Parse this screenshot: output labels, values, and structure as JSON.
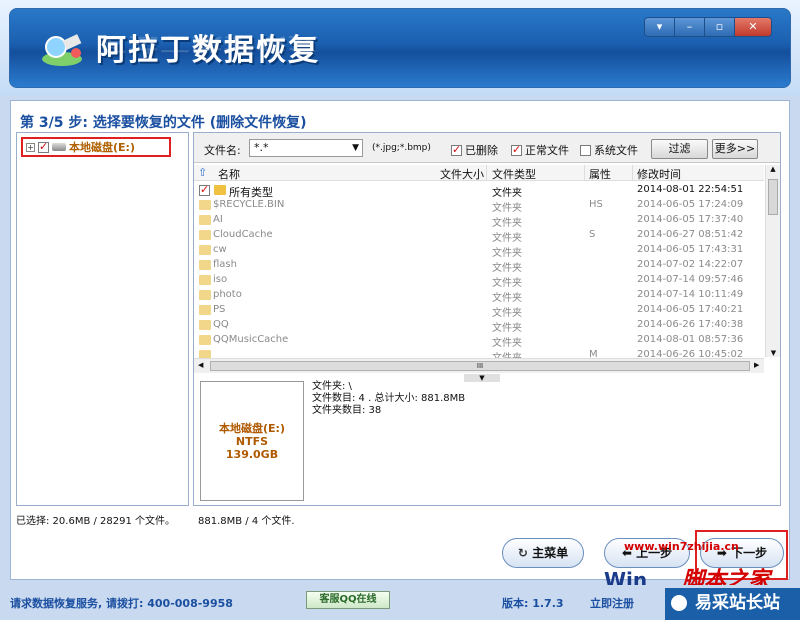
{
  "app": {
    "title": "阿拉丁数据恢复",
    "window_buttons": [
      "▾",
      "–",
      "▫",
      "✕"
    ]
  },
  "step_title": "第 3/5 步: 选择要恢复的文件 (删除文件恢复)",
  "tree": {
    "expander": "+",
    "root_label": "本地磁盘(E:)",
    "checked": true
  },
  "filter": {
    "label": "文件名:",
    "value": "*.*",
    "hint": "(*.jpg;*.bmp)",
    "deleted_label": "已删除",
    "deleted_checked": true,
    "normal_label": "正常文件",
    "normal_checked": true,
    "system_label": "系统文件",
    "system_checked": false,
    "filter_button": "过滤",
    "more_button": "更多>>"
  },
  "columns": [
    "名称",
    "文件大小",
    "文件类型",
    "属性",
    "修改时间"
  ],
  "rows": [
    {
      "name": "所有类型",
      "type": "文件夹",
      "attr": "",
      "time": "2014-08-01 22:54:51",
      "dim": false
    },
    {
      "name": "$RECYCLE.BIN",
      "type": "文件夹",
      "attr": "HS",
      "time": "2014-06-05 17:24:09",
      "dim": true
    },
    {
      "name": "AI",
      "type": "文件夹",
      "attr": "",
      "time": "2014-06-05 17:37:40",
      "dim": true
    },
    {
      "name": "CloudCache",
      "type": "文件夹",
      "attr": "S",
      "time": "2014-06-27 08:51:42",
      "dim": true
    },
    {
      "name": "cw",
      "type": "文件夹",
      "attr": "",
      "time": "2014-06-05 17:43:31",
      "dim": true
    },
    {
      "name": "flash",
      "type": "文件夹",
      "attr": "",
      "time": "2014-07-02 14:22:07",
      "dim": true
    },
    {
      "name": "iso",
      "type": "文件夹",
      "attr": "",
      "time": "2014-07-14 09:57:46",
      "dim": true
    },
    {
      "name": "photo",
      "type": "文件夹",
      "attr": "",
      "time": "2014-07-14 10:11:49",
      "dim": true
    },
    {
      "name": "PS",
      "type": "文件夹",
      "attr": "",
      "time": "2014-06-05 17:40:21",
      "dim": true
    },
    {
      "name": "QQ",
      "type": "文件夹",
      "attr": "",
      "time": "2014-06-26 17:40:38",
      "dim": true
    },
    {
      "name": "QQMusicCache",
      "type": "文件夹",
      "attr": "",
      "time": "2014-08-01 08:57:36",
      "dim": true
    },
    {
      "name": "",
      "type": "文件夹",
      "attr": "M",
      "time": "2014-06-26 10:45:02",
      "dim": true
    }
  ],
  "scrollbar_glyph": "III",
  "splitter_glyph": "▼",
  "drive_card": {
    "name": "本地磁盘(E:)",
    "fs": "NTFS",
    "size": "139.0GB"
  },
  "details": {
    "line1": "文件夹: \\",
    "line2": "文件数目: 4 . 总计大小: 881.8MB",
    "line3": "文件夹数目: 38"
  },
  "status": {
    "selected": "已选择: 20.6MB / 28291 个文件。",
    "summary": "881.8MB / 4 个文件."
  },
  "buttons": {
    "main_menu": "主菜单",
    "prev": "上一步",
    "next": "下一步"
  },
  "footer": {
    "service": "请求数据恢复服务, 请拨打: 400-008-9958",
    "qq": "客服QQ在线",
    "version": "版本: 1.7.3",
    "register": "立即注册"
  },
  "watermarks": {
    "site": "www.win7zhijia.cn",
    "home": "脚本之家",
    "win": "Win",
    "yicai": "易采站长站"
  },
  "colors": {
    "accent": "#1b4fa0",
    "highlight_red": "#e02020",
    "banner_blue": "#1b5fb0"
  }
}
